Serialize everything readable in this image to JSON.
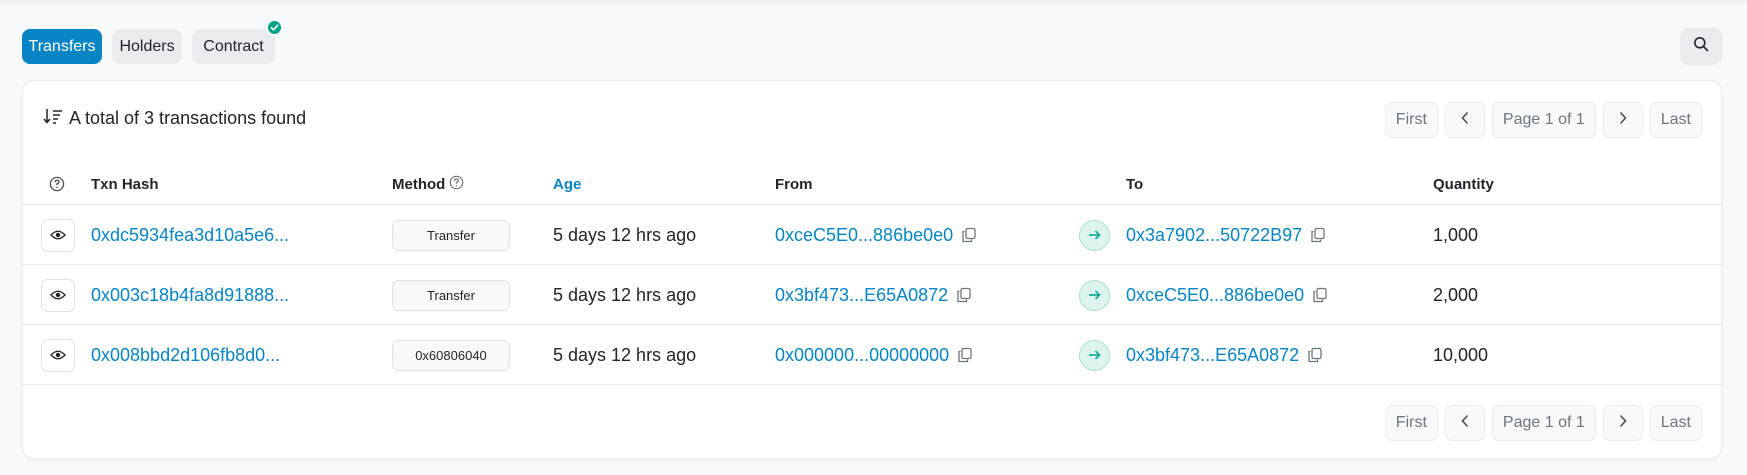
{
  "tabs": [
    {
      "label": "Transfers",
      "active": true
    },
    {
      "label": "Holders",
      "active": false
    },
    {
      "label": "Contract",
      "active": false,
      "verified": true
    }
  ],
  "summary": {
    "text": "A total of 3 transactions found"
  },
  "pagination": {
    "first": "First",
    "page": "Page 1 of 1",
    "last": "Last"
  },
  "table": {
    "headers": {
      "txn_hash": "Txn Hash",
      "method": "Method",
      "age": "Age",
      "from": "From",
      "to": "To",
      "quantity": "Quantity"
    },
    "rows": [
      {
        "hash": "0xdc5934fea3d10a5e6...",
        "method": "Transfer",
        "age": "5 days 12 hrs ago",
        "from": "0xceC5E0...886be0e0",
        "to": "0x3a7902...50722B97",
        "quantity": "1,000"
      },
      {
        "hash": "0x003c18b4fa8d91888...",
        "method": "Transfer",
        "age": "5 days 12 hrs ago",
        "from": "0x3bf473...E65A0872",
        "to": "0xceC5E0...886be0e0",
        "quantity": "2,000"
      },
      {
        "hash": "0x008bbd2d106fb8d0...",
        "method": "0x60806040",
        "age": "5 days 12 hrs ago",
        "from": "0x000000...00000000",
        "to": "0x3bf473...E65A0872",
        "quantity": "10,000"
      }
    ]
  },
  "colors": {
    "accent": "#0784c3",
    "verified": "#00a186",
    "direction_bg": "#dcf3ee"
  },
  "icons": [
    "sort-icon",
    "question-icon",
    "eye-icon",
    "copy-icon",
    "arrow-right-icon",
    "search-icon",
    "check-icon",
    "chevron-left-icon",
    "chevron-right-icon"
  ]
}
